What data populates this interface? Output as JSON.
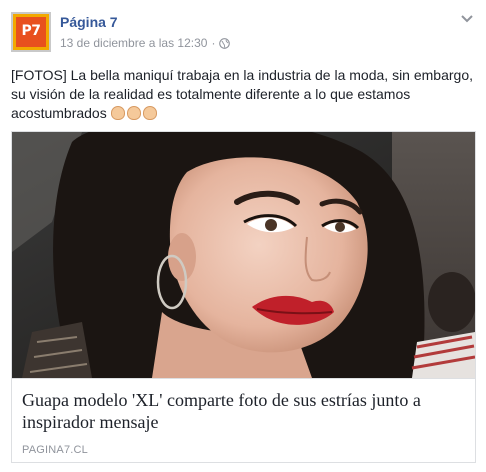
{
  "post": {
    "author": "Página 7",
    "avatar_text": "P7",
    "timestamp": "13 de diciembre a las 12:30",
    "separator": "·",
    "text": "[FOTOS] La bella maniquí trabaja en la industria de la moda, sin embargo, su visión de la realidad es totalmente diferente a lo que estamos acostumbrados",
    "emoji": [
      "clapping-hands-icon",
      "clapping-hands-icon",
      "flexed-biceps-icon"
    ],
    "link": {
      "title": "Guapa modelo 'XL' comparte foto de sus estrías junto a inspirador mensaje",
      "domain": "PAGINA7.CL"
    }
  },
  "colors": {
    "name": "#365899",
    "meta": "#90949c",
    "text": "#1d2129",
    "border": "#dddfe2",
    "avatar_bg": "#e8501e",
    "avatar_frame": "#f2a900"
  }
}
